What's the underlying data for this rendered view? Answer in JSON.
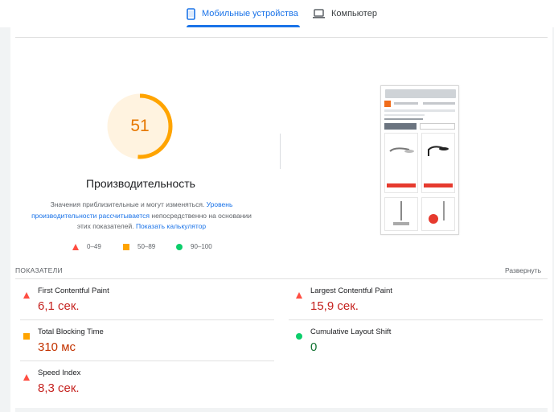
{
  "tabs": {
    "mobile_label": "Мобильные устройства",
    "desktop_label": "Компьютер"
  },
  "score": {
    "value": "51",
    "fraction": 0.51,
    "color": "#ffa400",
    "title": "Производительность",
    "desc_part1": "Значения приблизительные и могут изменяться. ",
    "desc_link1": "Уровень производительности рассчитывается",
    "desc_part2": " непосредственно на основании этих показателей. ",
    "desc_link2": "Показать калькулятор"
  },
  "legend": {
    "poor": "0–49",
    "average": "50–89",
    "good": "90–100"
  },
  "metrics": {
    "header": "ПОКАЗАТЕЛИ",
    "expand": "Развернуть",
    "items": [
      {
        "name": "First Contentful Paint",
        "value": "6,1 сек.",
        "status": "poor"
      },
      {
        "name": "Largest Contentful Paint",
        "value": "15,9 сек.",
        "status": "poor"
      },
      {
        "name": "Total Blocking Time",
        "value": "310 мс",
        "status": "average"
      },
      {
        "name": "Cumulative Layout Shift",
        "value": "0",
        "status": "good"
      },
      {
        "name": "Speed Index",
        "value": "8,3 сек.",
        "status": "poor"
      }
    ]
  },
  "colors": {
    "accent": "#1a73e8",
    "poor": "#ff4e42",
    "average": "#ffa400",
    "good": "#0cce6b"
  }
}
